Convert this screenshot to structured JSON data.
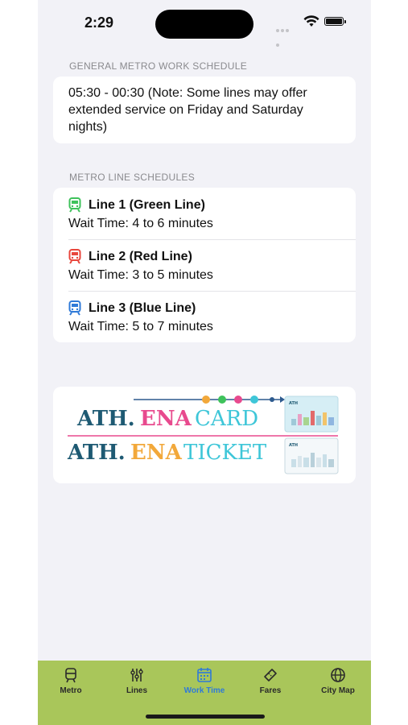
{
  "status": {
    "time": "2:29"
  },
  "general": {
    "header": "GENERAL METRO WORK SCHEDULE",
    "text": "05:30 - 00:30 (Note: Some lines may offer extended service on Friday and Saturday nights)"
  },
  "lines_section": {
    "header": "METRO LINE SCHEDULES",
    "lines": [
      {
        "title": "Line 1 (Green Line)",
        "wait": "Wait Time: 4 to 6 minutes",
        "color": "#3ec25b"
      },
      {
        "title": "Line 2 (Red Line)",
        "wait": "Wait Time: 3 to 5 minutes",
        "color": "#e8463c"
      },
      {
        "title": "Line 3 (Blue Line)",
        "wait": "Wait Time: 5 to 7 minutes",
        "color": "#2f7ad8"
      }
    ]
  },
  "banner": {
    "card_logo": {
      "ath": "ATH.",
      "ena": "ENA",
      "rest": "CARD"
    },
    "ticket_logo": {
      "ath": "ATH.",
      "ena": "ENA",
      "rest": "TICKET"
    },
    "mini_card_label": "ATH",
    "mini_ticket_label": "ATH"
  },
  "tabbar": {
    "tabs": [
      {
        "label": "Metro",
        "icon": "train-icon"
      },
      {
        "label": "Lines",
        "icon": "lines-icon"
      },
      {
        "label": "Work Time",
        "icon": "calendar-icon",
        "active": true
      },
      {
        "label": "Fares",
        "icon": "ticket-icon"
      },
      {
        "label": "City Map",
        "icon": "globe-icon"
      }
    ],
    "background": "#a9c65a",
    "active_color": "#2f7ad8"
  }
}
